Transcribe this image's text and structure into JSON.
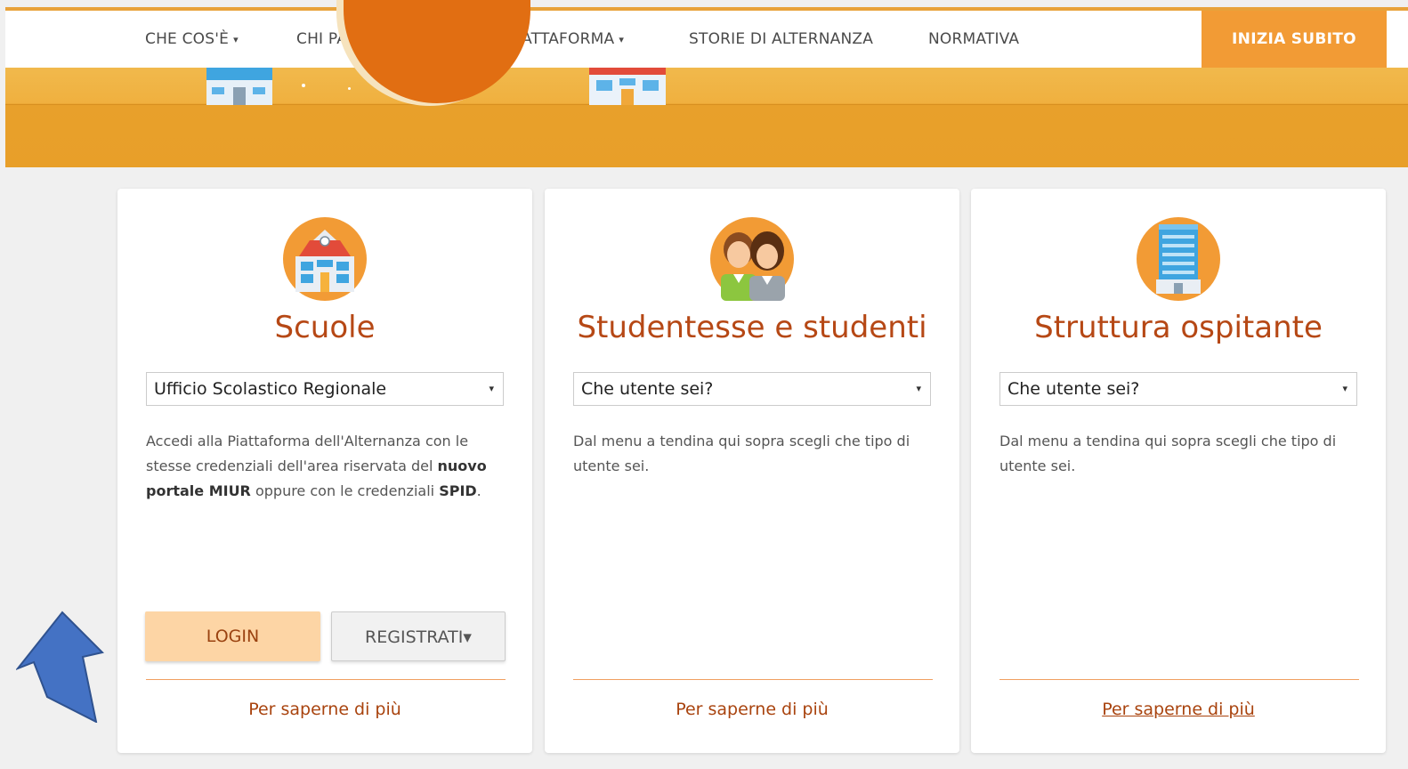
{
  "nav": {
    "items": [
      {
        "label": "CHE COS'È",
        "caret": "▾"
      },
      {
        "label": "CHI PARTECIPA",
        "caret": "▾"
      },
      {
        "label": "LA PIATTAFORMA",
        "caret": "▾"
      },
      {
        "label": "STORIE DI ALTERNANZA",
        "caret": ""
      },
      {
        "label": "NORMATIVA",
        "caret": ""
      }
    ],
    "cta": "INIZIA SUBITO"
  },
  "cards": [
    {
      "icon": "school-icon",
      "title": "Scuole",
      "select_value": "Ufficio Scolastico Regionale",
      "desc_1": "Accedi alla Piattaforma dell'Alternanza con le stesse credenziali dell'area riservata del ",
      "desc_b1": "nuovo portale MIUR",
      "desc_2": " oppure con le credenziali ",
      "desc_b2": "SPID",
      "desc_3": ".",
      "login": "LOGIN",
      "register": "REGISTRATI",
      "register_caret": "▾",
      "more": "Per saperne di più"
    },
    {
      "icon": "students-icon",
      "title": "Studentesse e studenti",
      "select_value": "Che utente sei?",
      "desc": "Dal menu a tendina qui sopra scegli che tipo di utente sei.",
      "more": "Per saperne di più"
    },
    {
      "icon": "office-building-icon",
      "title": "Struttura ospitante",
      "select_value": "Che utente sei?",
      "desc": "Dal menu a tendina qui sopra scegli che tipo di utente sei.",
      "more": "Per saperne di più"
    }
  ],
  "select_arrow": "▾",
  "colors": {
    "accent": "#f29b35",
    "hero": "#e89f29",
    "title": "#b64815",
    "link": "#a9440f",
    "login_bg": "#fdd5a5",
    "pointer": "#4472c4"
  }
}
